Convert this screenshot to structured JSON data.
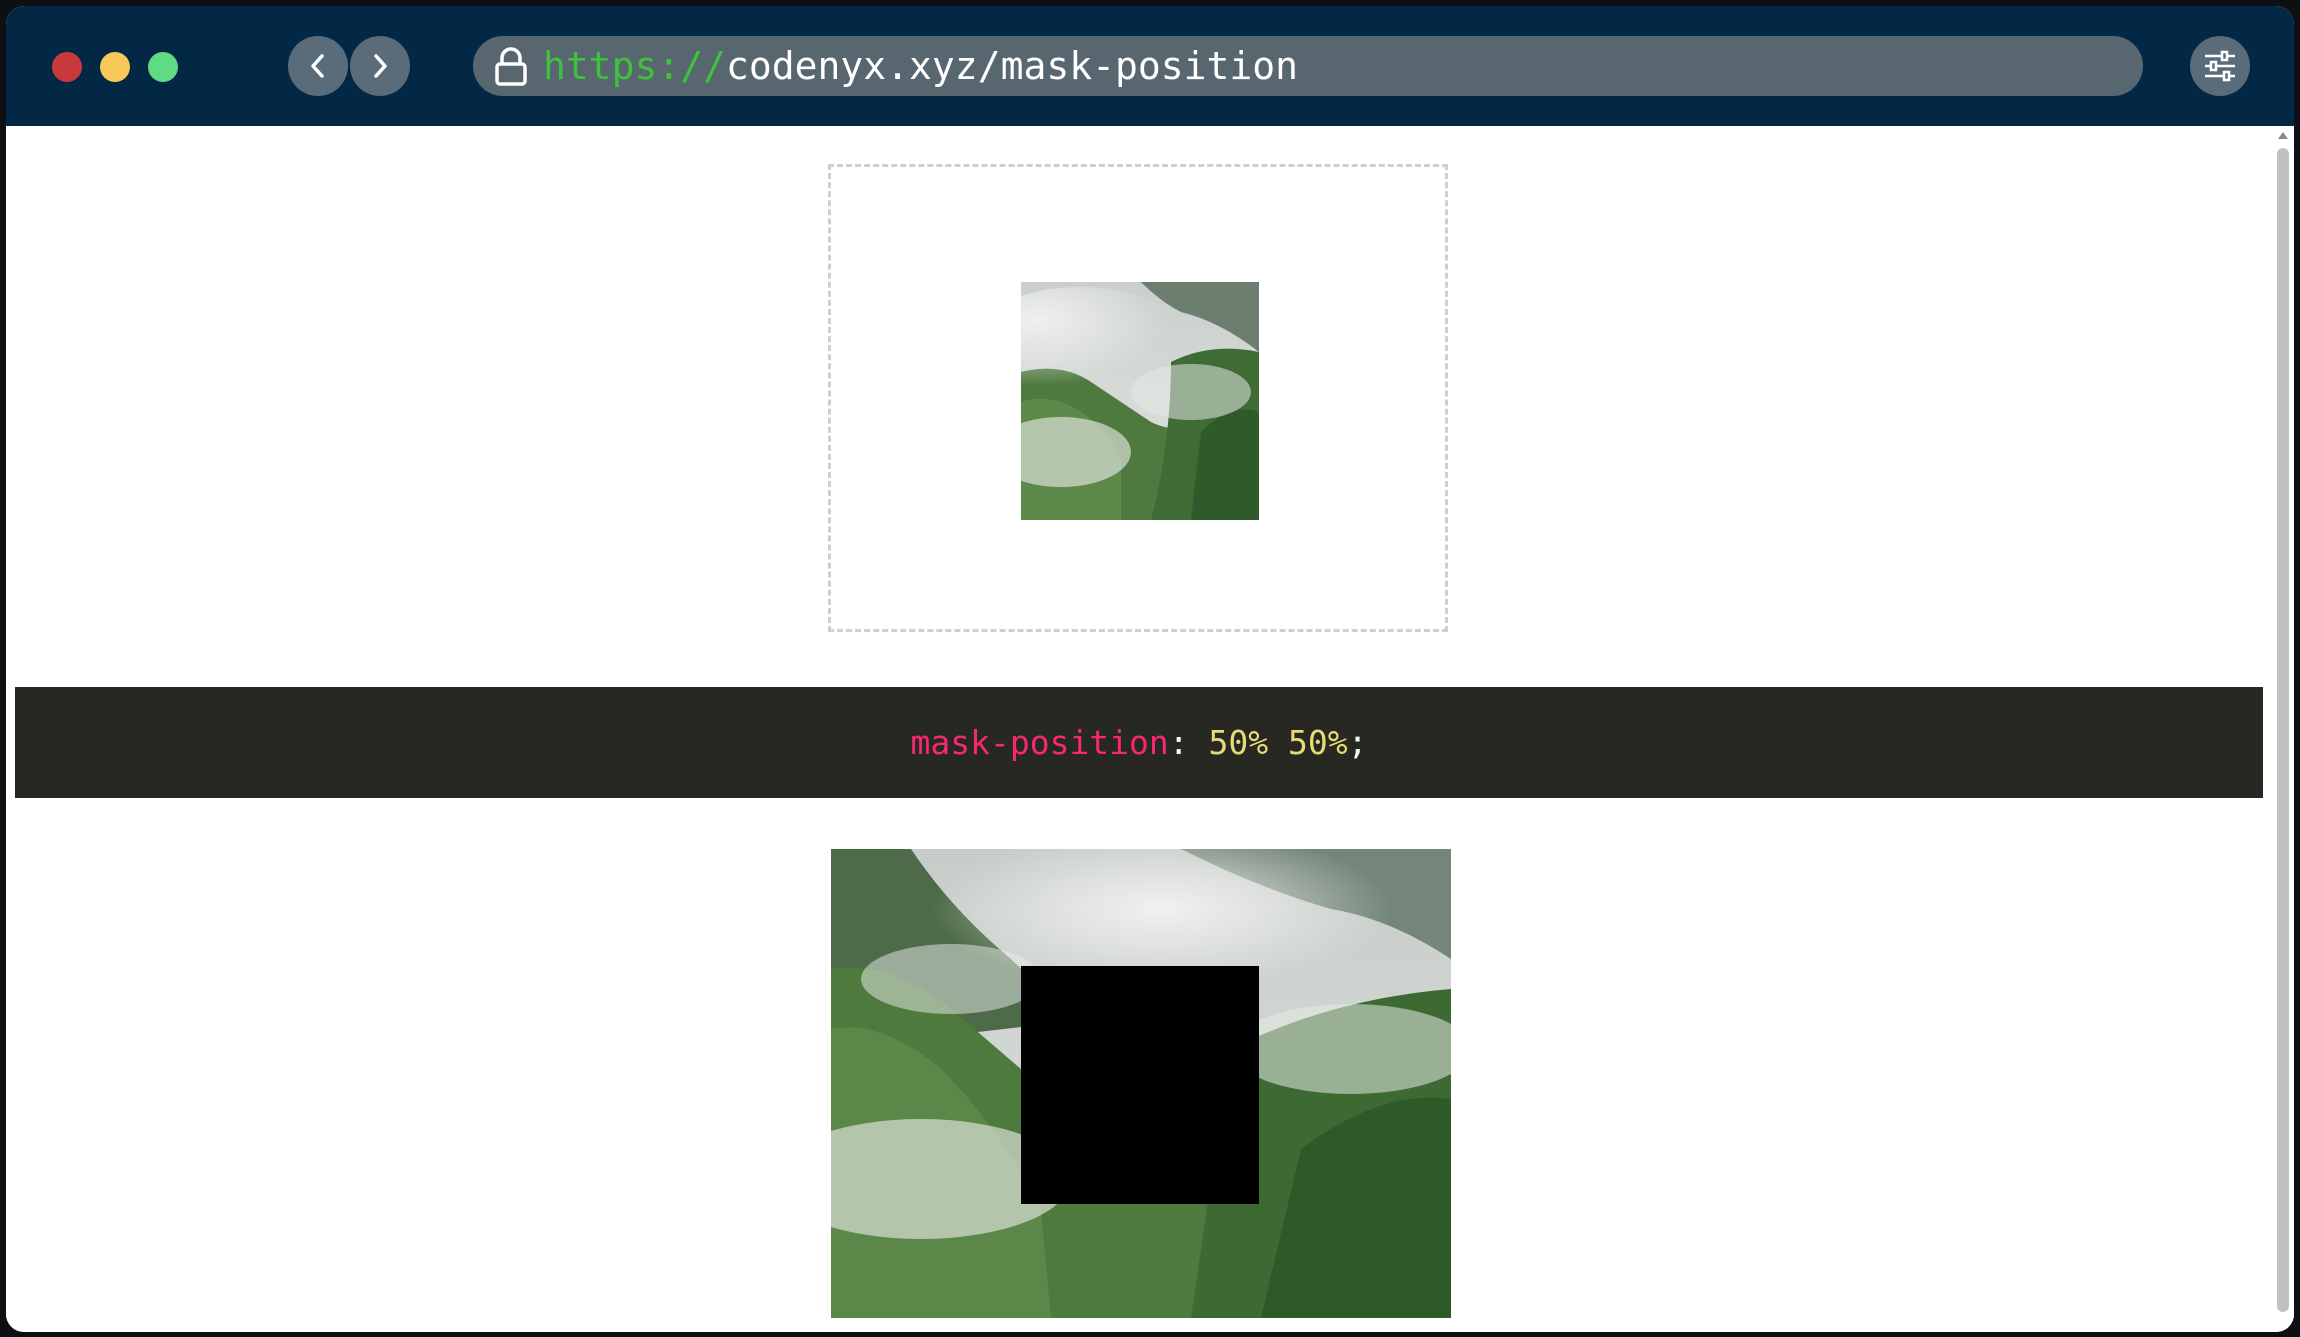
{
  "browser": {
    "url_scheme": "https://",
    "url_rest": "codenyx.xyz/mask-position",
    "controls": [
      "close",
      "minimize",
      "maximize"
    ],
    "icons": {
      "back": "chevron-left-icon",
      "forward": "chevron-right-icon",
      "lock": "lock-icon",
      "settings": "sliders-icon"
    }
  },
  "code": {
    "property": "mask-position",
    "colon": ":",
    "value": "50% 50%",
    "semicolon": ";"
  },
  "colors": {
    "titlebar": "#032845",
    "url_scheme": "#3cc23c",
    "code_bg": "#272822",
    "code_property": "#f92672",
    "code_value": "#e6db74"
  }
}
